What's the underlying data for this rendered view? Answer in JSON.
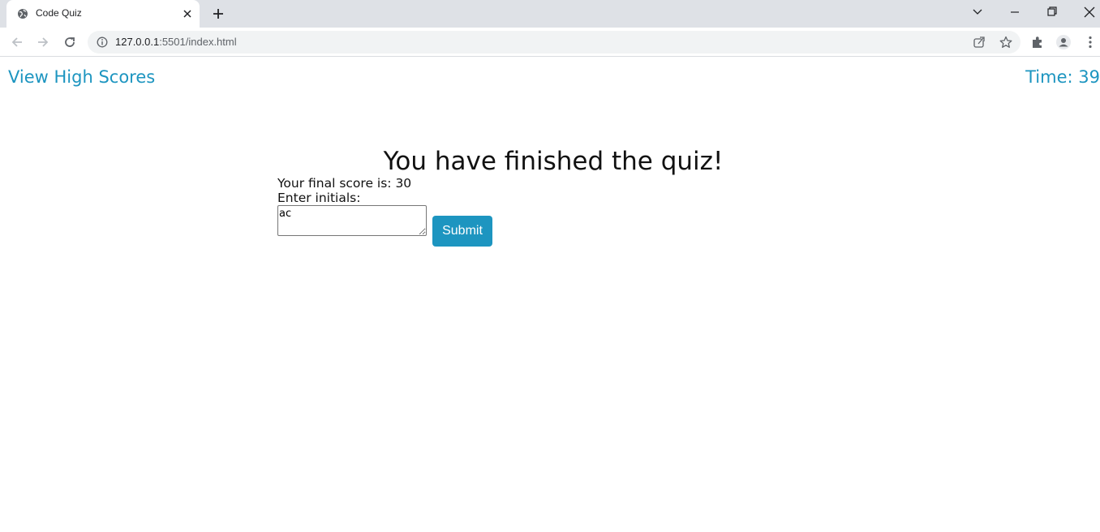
{
  "browser": {
    "tab_title": "Code Quiz",
    "url_host": "127.0.0.1",
    "url_rest": ":5501/index.html"
  },
  "page": {
    "high_scores_link": "View High Scores",
    "timer": "Time: 39",
    "end_title": "You have finished the quiz!",
    "final_score": "Your final score is: 30",
    "initials_label": "Enter initials:",
    "initials_value": "ac",
    "submit_label": "Submit"
  },
  "colors": {
    "accent": "#1d95c0",
    "tabstrip": "#dee1e6",
    "omnibox": "#f1f3f4"
  },
  "icons": [
    "globe-icon",
    "close-icon",
    "plus-icon",
    "chevron-down-icon",
    "minimize-icon",
    "restore-icon",
    "window-close-icon",
    "back-icon",
    "forward-icon",
    "reload-icon",
    "info-icon",
    "share-icon",
    "star-icon",
    "extensions-icon",
    "profile-icon",
    "kebab-menu-icon"
  ]
}
